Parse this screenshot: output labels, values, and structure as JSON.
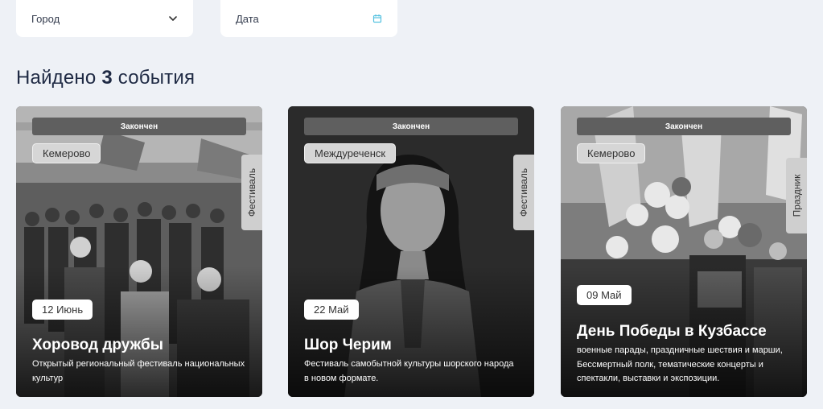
{
  "filters": {
    "city_label": "Город",
    "date_label": "Дата"
  },
  "results": {
    "prefix": "Найдено",
    "count": "3",
    "suffix": "события"
  },
  "events": [
    {
      "status": "Закончен",
      "city": "Кемерово",
      "category": "Фестиваль",
      "date": "12 Июнь",
      "title": "Хоровод дружбы",
      "description": "Открытый региональный фестиваль национальных культур"
    },
    {
      "status": "Закончен",
      "city": "Междуреченск",
      "category": "Фестиваль",
      "date": "22 Май",
      "title": "Шор Черим",
      "description": "Фестиваль самобытной культуры шорского народа в новом формате."
    },
    {
      "status": "Закончен",
      "city": "Кемерово",
      "category": "Праздник",
      "date": "09 Май",
      "title": "День Победы в Кузбассе",
      "description": "военные парады, праздничные шествия и марши, Бессмертный полк, тематические концерты и спектакли, выставки и экспозиции."
    }
  ],
  "colors": {
    "page_bg": "#eef1f6",
    "heading": "#1f2a44",
    "accent": "#55c1e0"
  }
}
